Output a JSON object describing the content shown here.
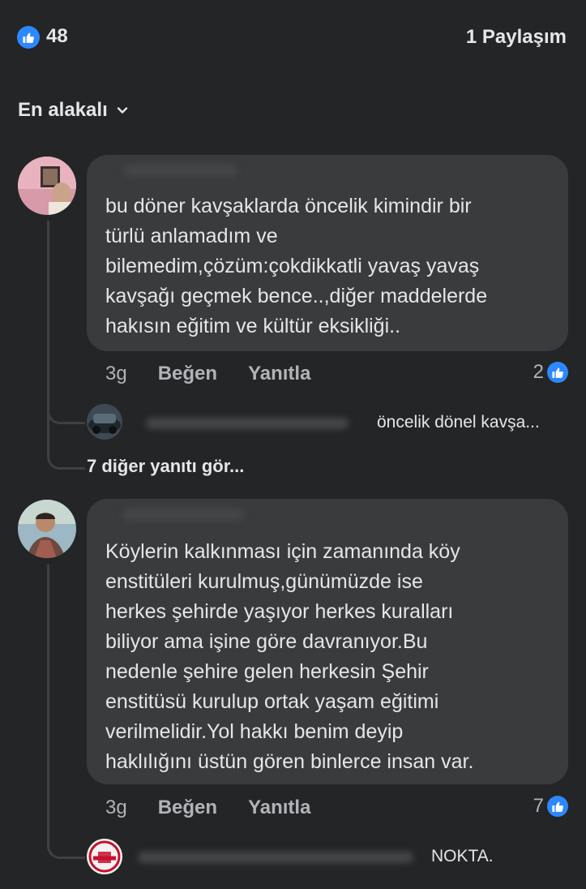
{
  "header": {
    "like_count": "48",
    "shares": "1 Paylaşım"
  },
  "sort": {
    "label": "En alakalı"
  },
  "comments": [
    {
      "text_lines": [
        "bu döner kavşaklarda öncelik kimindir bir",
        "türlü anlamadım ve",
        "bilemedim,çözüm:çokdikkatli yavaş yavaş",
        "kavşağı geçmek bence..,diğer maddelerde",
        "hakısın eğitim ve kültür eksikliği.."
      ],
      "time": "3g",
      "like_label": "Beğen",
      "reply_label": "Yanıtla",
      "reaction_count": "2",
      "reply_preview": "öncelik dönel kavşa...",
      "more_replies": "7 diğer yanıtı gör..."
    },
    {
      "text_lines": [
        "Köylerin kalkınması için zamanında köy",
        "enstitüleri kurulmuş,günümüzde ise",
        "herkes şehirde yaşıyor herkes kuralları",
        "biliyor ama işine göre davranıyor.Bu",
        "nedenle şehire gelen herkesin Şehir",
        "enstitüsü kurulup ortak yaşam eğitimi",
        "verilmelidir.Yol hakkı benim deyip",
        "haklılığını üstün gören binlerce insan var."
      ],
      "time": "3g",
      "like_label": "Beğen",
      "reply_label": "Yanıtla",
      "reaction_count": "7",
      "reply_preview": "NOKTA."
    }
  ],
  "colors": {
    "background": "#242526",
    "bubble": "#3a3b3c",
    "like_blue": "#2d88ff",
    "secondary_text": "#b0b3b8"
  }
}
